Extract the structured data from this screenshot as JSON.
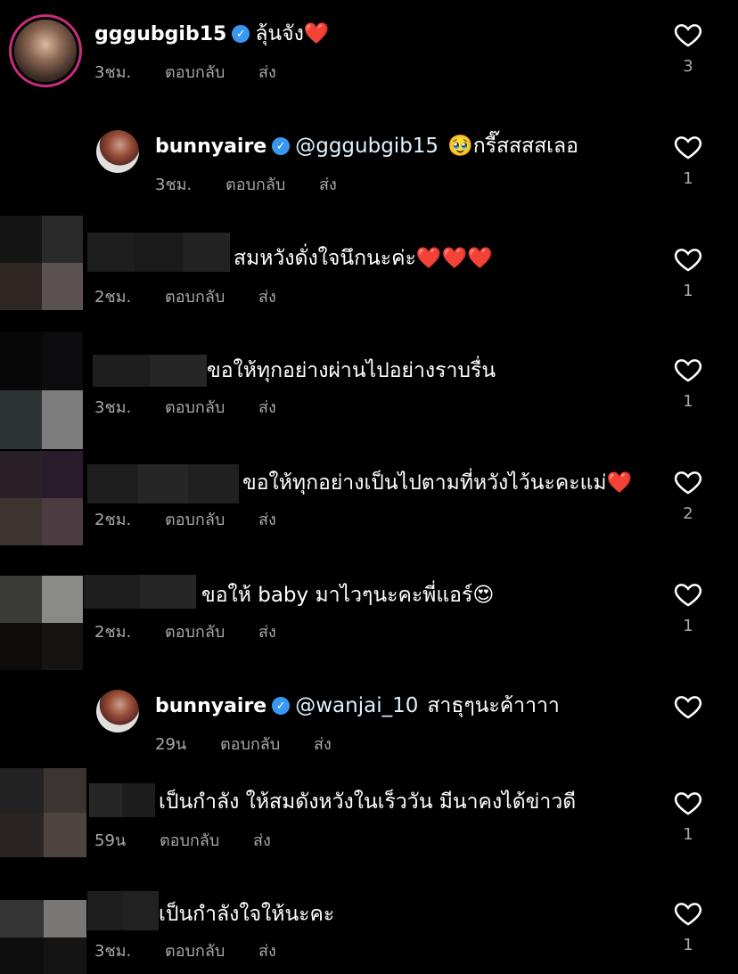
{
  "meta_labels": {
    "reply": "ตอบกลับ",
    "send": "ส่ง"
  },
  "comments": [
    {
      "user": "gggubgib15",
      "verified": true,
      "text": "ลุ้นจัง❤️",
      "time": "3ชม.",
      "likes": "3"
    },
    {
      "user": "bunnyaire",
      "verified": true,
      "mention": "@gggubgib15",
      "text": "🥹กรี๊สสสสเลอ",
      "time": "3ชม.",
      "likes": "1"
    },
    {
      "text": "สมหวังดั่งใจนึกนะค่ะ❤️❤️❤️",
      "time": "2ชม.",
      "likes": "1"
    },
    {
      "text": "ขอให้ทุกอย่างผ่านไปอย่างราบรื่น",
      "time": "3ชม.",
      "likes": "1"
    },
    {
      "text": "ขอให้ทุกอย่างเป็นไปตามที่หวังไว้นะคะแม่❤️",
      "time": "2ชม.",
      "likes": "2"
    },
    {
      "text": "ขอให้ baby มาไวๆนะคะพี่แอร์😍",
      "time": "2ชม.",
      "likes": "1"
    },
    {
      "user": "bunnyaire",
      "verified": true,
      "mention": "@wanjai_10",
      "text": "สาธุๆนะค้าาาา",
      "time": "29น",
      "likes": ""
    },
    {
      "text": "เป็นกำลัง ให้สมดังหวังในเร็ววัน มีนาคงได้ข่าวดี",
      "time": "59น",
      "likes": "1"
    },
    {
      "text": "เป็นกำลังใจให้นะคะ",
      "time": "3ชม.",
      "likes": "1"
    }
  ],
  "icons": {
    "like": "heart-outline-icon",
    "verified": "verified-badge-icon"
  }
}
